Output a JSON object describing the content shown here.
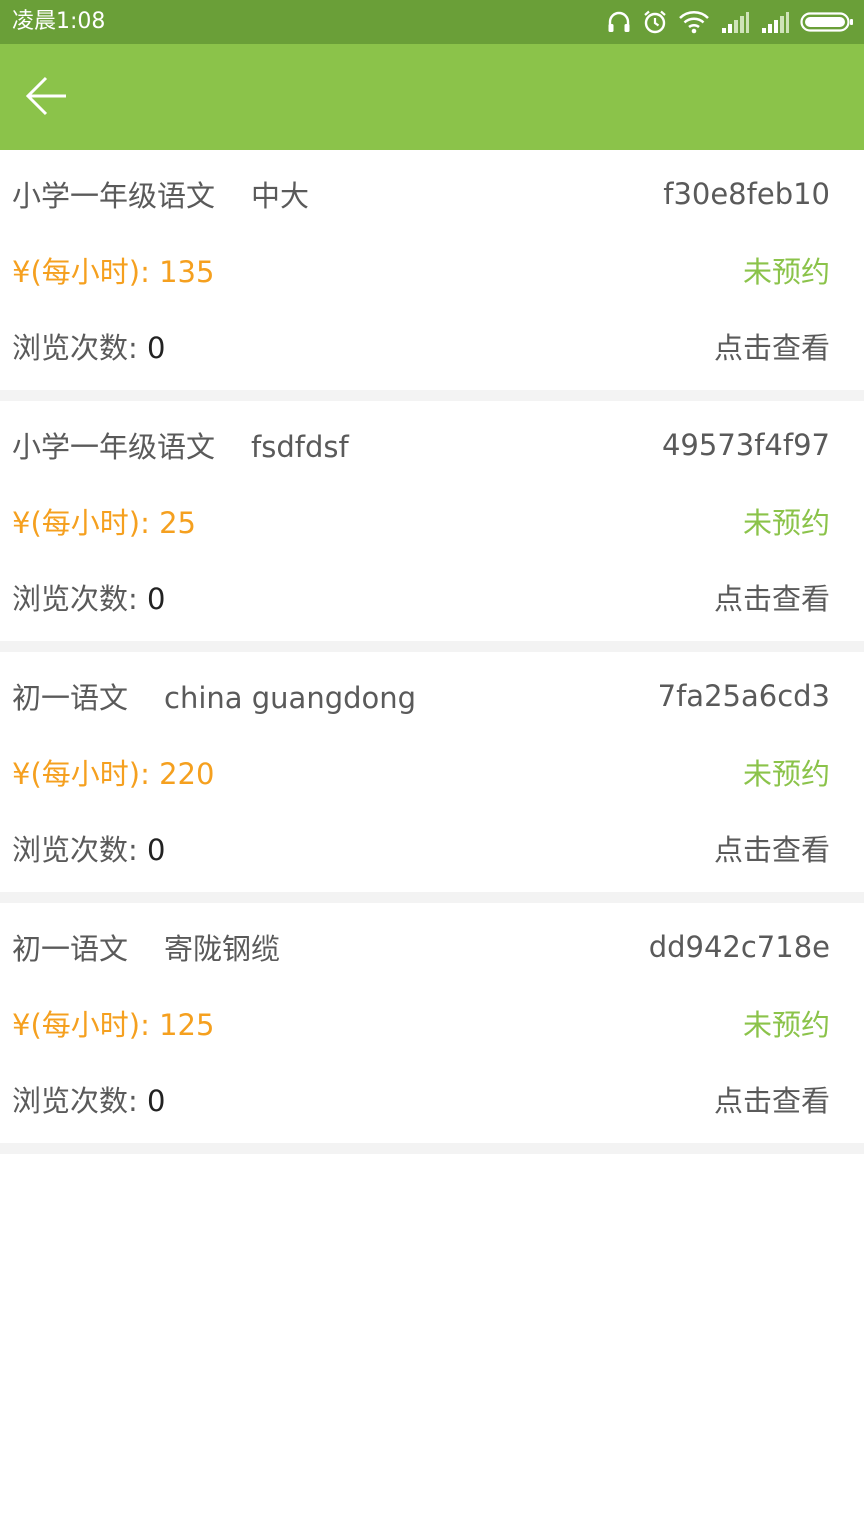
{
  "status_bar": {
    "time": "凌晨1:08",
    "icons": [
      "headset-icon",
      "alarm-icon",
      "wifi-icon",
      "signal-icon",
      "signal-icon",
      "battery-icon"
    ]
  },
  "app_bar": {
    "back_icon": "arrow-left-icon"
  },
  "items": [
    {
      "subject": "小学一年级语文",
      "teacher": "中大",
      "code": "f30e8feb10",
      "price_label": "¥(每小时):",
      "price": "135",
      "status": "未预约",
      "views_label": "浏览次数:",
      "views": "0",
      "action": "点击查看"
    },
    {
      "subject": "小学一年级语文",
      "teacher": "fsdfdsf",
      "code": "49573f4f97",
      "price_label": "¥(每小时):",
      "price": "25",
      "status": "未预约",
      "views_label": "浏览次数:",
      "views": "0",
      "action": "点击查看"
    },
    {
      "subject": "初一语文",
      "teacher": "china guangdong",
      "code": "7fa25a6cd3",
      "price_label": "¥(每小时):",
      "price": "220",
      "status": "未预约",
      "views_label": "浏览次数:",
      "views": "0",
      "action": "点击查看"
    },
    {
      "subject": "初一语文",
      "teacher": "寄陇钢缆",
      "code": "dd942c718e",
      "price_label": "¥(每小时):",
      "price": "125",
      "status": "未预约",
      "views_label": "浏览次数:",
      "views": "0",
      "action": "点击查看"
    }
  ],
  "colors": {
    "status_bar": "#6a9f38",
    "app_bar": "#8bc34a",
    "price": "#f5a01f",
    "status": "#8bc34a"
  }
}
